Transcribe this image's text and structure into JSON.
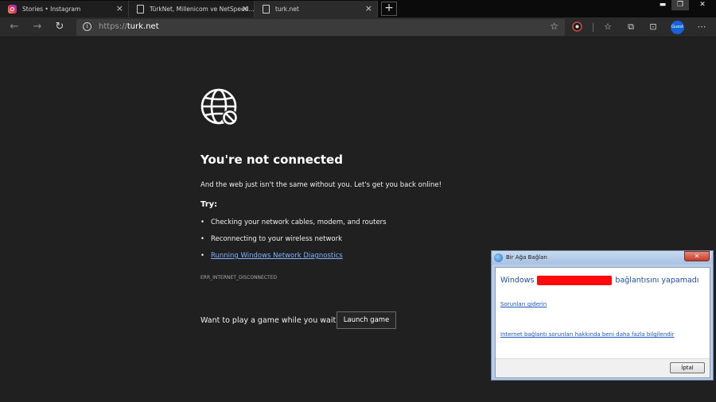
{
  "tabs": [
    {
      "label": "Stories • Instagram",
      "favicon": "instagram-icon"
    },
    {
      "label": "TürkNet, Millenicom ve NetSpeed...",
      "favicon": "page-icon"
    },
    {
      "label": "turk.net",
      "favicon": "page-icon"
    }
  ],
  "toolbar": {
    "url_prefix": "https://",
    "url_host": "turk.net",
    "profile_label": "Guest"
  },
  "error_page": {
    "heading": "You're not connected",
    "lead": "And the web just isn't the same without you. Let's get you back online!",
    "try_label": "Try:",
    "bullets": [
      "Checking your network cables, modem, and routers",
      "Reconnecting to your wireless network",
      "Running Windows Network Diagnostics"
    ],
    "error_code": "ERR_INTERNET_DISCONNECTED",
    "game_question": "Want to play a game while you wait?",
    "game_button": "Launch game"
  },
  "dialog": {
    "title": "Bir Ağa Bağlan",
    "message_prefix": "Windows",
    "message_suffix": "bağlantısını yapamadı",
    "link_troubleshoot": "Sorunları giderin",
    "link_learn_more": "Internet bağlantı sorunları hakkında beni daha fazla bilgilendir",
    "cancel_button": "İptal"
  },
  "colors": {
    "page_bg": "#202020",
    "link_blue": "#7fb1ff",
    "redaction": "#ff0a0a"
  }
}
